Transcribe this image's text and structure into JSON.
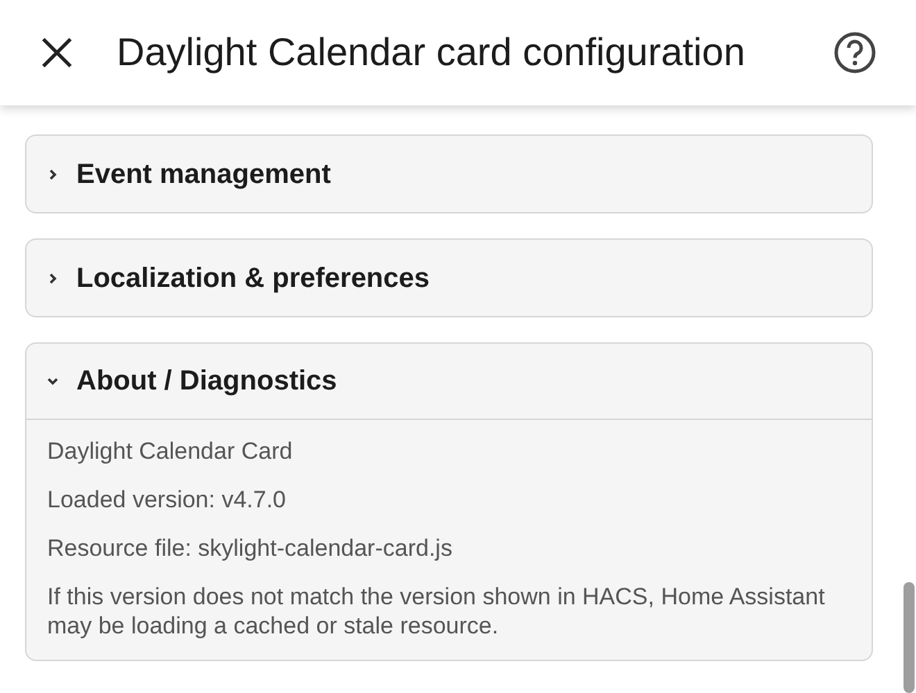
{
  "header": {
    "title": "Daylight Calendar card configuration"
  },
  "sections": [
    {
      "title": "Event management",
      "expanded": false
    },
    {
      "title": "Localization & preferences",
      "expanded": false
    },
    {
      "title": "About / Diagnostics",
      "expanded": true,
      "lines": [
        "Daylight Calendar Card",
        "Loaded version: v4.7.0",
        "Resource file: skylight-calendar-card.js",
        "If this version does not match the version shown in HACS, Home Assistant may be loading a cached or stale resource."
      ]
    }
  ]
}
